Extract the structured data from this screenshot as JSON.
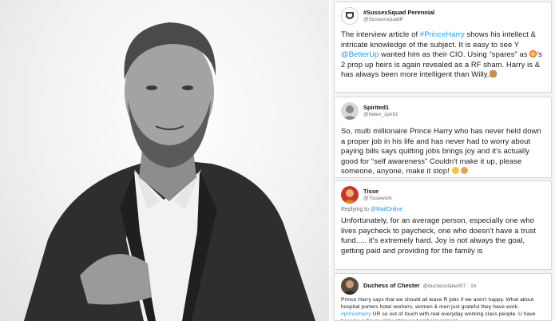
{
  "tweets": [
    {
      "name": "#SussexSquad Perennial",
      "handle": "@SussexsquadP",
      "text_before": "The interview article of ",
      "hashtag": "#PrinceHarry",
      "text_mid1": " shows his intellect & intricate knowledge of the subject. It is easy to see Y ",
      "mention": "@BetterUp",
      "text_mid2": " wanted him as their CIO. Using “spares” as ",
      "text_mid3": "'s 2 prop up heirs is again revealed as a RF sham. Harry is & has always been more intelligent than Willy.",
      "emoji_clown": "clown-emoji",
      "emoji_hands": "folded-hands-emoji"
    },
    {
      "name": "Spirited1",
      "handle": "@helen_spirit1",
      "text": "So, multi millionaire Prince Harry who has never held down a proper job in his life and has never had to worry about paying bills says quitting jobs brings joy and it's actually good for “self awareness” Couldn't make it up, please someone, anyone, make it stop! ",
      "emoji": "laughing-emoji"
    },
    {
      "name": "Tisse",
      "handle": "@Tissework",
      "reply_prefix": "Replying to ",
      "reply_mention": "@MailOnline",
      "text": "Unfortunately, for an average person, especially one who lives paycheck to paycheck, one who doesn't have a trust fund..... it's extremely hard.  Joy is not always the goal, getting paid and providing for the family is"
    },
    {
      "name": "Duchess of Chester",
      "handle": "@duchessfake007 · 1h",
      "text_before": "Prince Harry says that we should all leave R jobs if we aren't happy. What about hospital porters hotel workers, women & men just grateful they have work. ",
      "hashtag": "#princeharry",
      "text_after": " UR so out of touch with real everyday working class people. U have become a figure of laughter and embarrassment"
    }
  ],
  "colors": {
    "link": "#1d9bf0",
    "text": "#1a1a1a",
    "muted": "#6b6b6b"
  }
}
